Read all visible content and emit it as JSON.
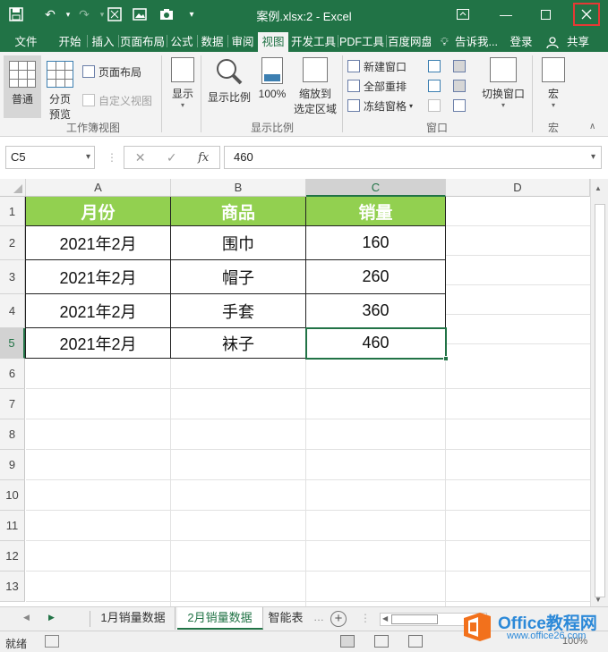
{
  "window": {
    "title": "案例.xlsx:2  -  Excel"
  },
  "tabs": [
    {
      "label": "文件"
    },
    {
      "label": "开始"
    },
    {
      "label": "插入"
    },
    {
      "label": "页面布局"
    },
    {
      "label": "公式"
    },
    {
      "label": "数据"
    },
    {
      "label": "审阅"
    },
    {
      "label": "视图"
    },
    {
      "label": "开发工具"
    },
    {
      "label": "PDF工具"
    },
    {
      "label": "百度网盘"
    },
    {
      "label": "告诉我..."
    },
    {
      "label": "登录"
    },
    {
      "label": "共享"
    }
  ],
  "ribbon": {
    "workbook_views": {
      "normal": "普通",
      "page_break_1": "分页",
      "page_break_2": "预览",
      "page_layout": "页面布局",
      "custom_views": "自定义视图",
      "group_label": "工作簿视图"
    },
    "show": {
      "label": "显示"
    },
    "zoom": {
      "zoom": "显示比例",
      "hundred": "100%",
      "zoom_sel_1": "缩放到",
      "zoom_sel_2": "选定区域",
      "group_label": "显示比例"
    },
    "window": {
      "new_window": "新建窗口",
      "arrange_all": "全部重排",
      "freeze_panes": "冻结窗格",
      "switch_windows": "切换窗口",
      "group_label": "窗口"
    },
    "macros": {
      "label": "宏",
      "group_label": "宏"
    }
  },
  "formula_bar": {
    "name_box": "C5",
    "fx": "fx",
    "value": "460"
  },
  "columns": [
    "A",
    "B",
    "C",
    "D"
  ],
  "rows": [
    "1",
    "2",
    "3",
    "4",
    "5",
    "6",
    "7",
    "8",
    "9",
    "10",
    "11",
    "12",
    "13"
  ],
  "table": {
    "headers": [
      "月份",
      "商品",
      "销量"
    ],
    "rows": [
      [
        "2021年2月",
        "围巾",
        "160"
      ],
      [
        "2021年2月",
        "帽子",
        "260"
      ],
      [
        "2021年2月",
        "手套",
        "360"
      ],
      [
        "2021年2月",
        "袜子",
        "460"
      ]
    ]
  },
  "selected_cell": "C5",
  "sheets": [
    {
      "label": "1月销量数据"
    },
    {
      "label": "2月销量数据"
    },
    {
      "label": "智能表"
    }
  ],
  "watermark": {
    "brand": "Office教程网",
    "url": "www.office26.com"
  },
  "status": {
    "text": "就绪",
    "zoom": "100%"
  },
  "colors": {
    "accent": "#217346",
    "header_fill": "#92d050",
    "close_highlight": "#e53935"
  }
}
